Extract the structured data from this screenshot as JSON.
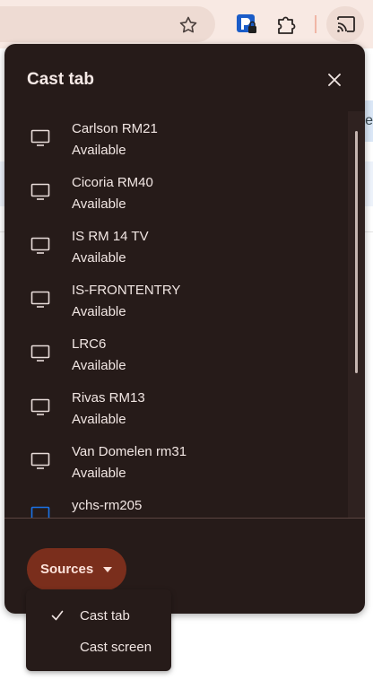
{
  "browser": {
    "bookmark_icon": "star-icon",
    "extensions": [
      "password-manager-icon",
      "puzzle-icon"
    ],
    "cast_icon": "cast-icon"
  },
  "page_edge_text": "e",
  "dialog": {
    "title": "Cast tab",
    "close_icon": "close-icon",
    "sinks": [
      {
        "name": "Carlson RM21",
        "status": "Available"
      },
      {
        "name": "Cicoria RM40",
        "status": "Available"
      },
      {
        "name": "IS RM 14 TV",
        "status": "Available"
      },
      {
        "name": "IS-FRONTENTRY",
        "status": "Available"
      },
      {
        "name": "LRC6",
        "status": "Available"
      },
      {
        "name": "Rivas RM13",
        "status": "Available"
      },
      {
        "name": "Van Domelen rm31",
        "status": "Available"
      },
      {
        "name": "ychs-rm205",
        "status": ""
      }
    ],
    "sources_label": "Sources"
  },
  "menu": {
    "items": [
      {
        "label": "Cast tab",
        "checked": true
      },
      {
        "label": "Cast screen",
        "checked": false
      }
    ]
  },
  "colors": {
    "dialog_bg": "#261b19",
    "sources_bg": "#7a2e1c",
    "highlight_tv": "#1a73e8"
  }
}
